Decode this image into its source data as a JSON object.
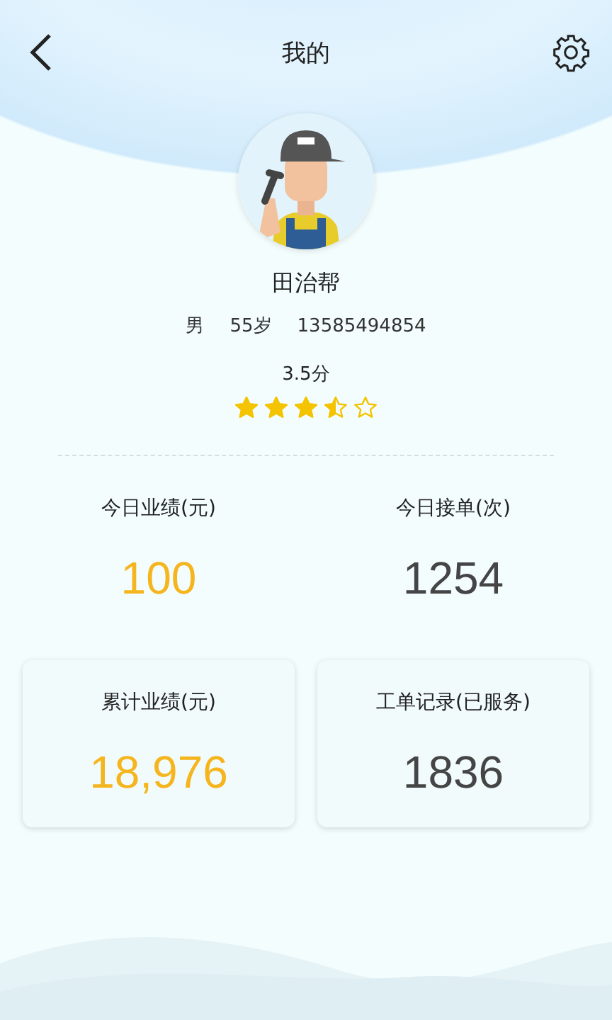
{
  "header": {
    "title": "我的"
  },
  "profile": {
    "name": "田治帮",
    "gender": "男",
    "age": "55岁",
    "phone": "13585494854",
    "score": "3.5分",
    "stars": 3.5
  },
  "stats": [
    {
      "kind": "plain",
      "label": "今日业绩(元)",
      "value": "100",
      "color": "#f5b51e"
    },
    {
      "kind": "plain",
      "label": "今日接单(次)",
      "value": "1254",
      "color": "#454545"
    },
    {
      "kind": "card",
      "label": "累计业绩(元)",
      "value": "18,976",
      "color": "#f5b51e"
    },
    {
      "kind": "card",
      "label": "工单记录(已服务)",
      "value": "1836",
      "color": "#454545"
    }
  ]
}
